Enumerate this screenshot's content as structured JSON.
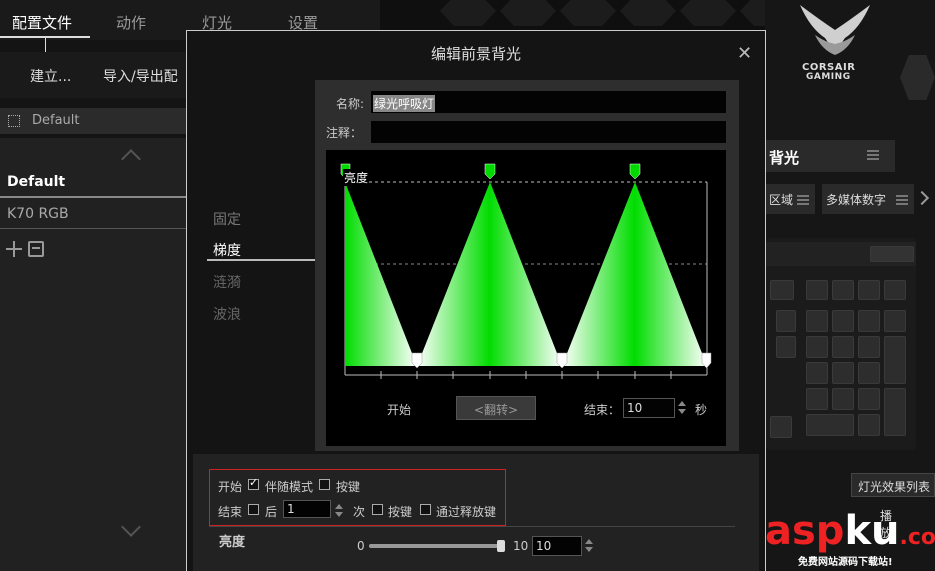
{
  "top_tabs": [
    {
      "label": "配置文件",
      "active": true
    },
    {
      "label": "动作",
      "active": false
    },
    {
      "label": "灯光",
      "active": false
    },
    {
      "label": "设置",
      "active": false
    }
  ],
  "left_actions": {
    "create": "建立...",
    "import_export": "导入/导出配"
  },
  "profile_bar": {
    "label": "Default"
  },
  "profiles": [
    "Default",
    "K70 RGB"
  ],
  "brand": {
    "line1": "CORSAIR",
    "line2": "GAMING"
  },
  "right_panel": {
    "header": "背光",
    "tabs": [
      "区域",
      "多媒体数字"
    ],
    "effect_list_button": "灯光效果列表",
    "play_button": "播放"
  },
  "watermark": {
    "main_a": "asp",
    "main_b": "ku",
    "main_c": ".com",
    "sub": "免费网站源码下载站!"
  },
  "dialog": {
    "title": "编辑前景背光",
    "name_label": "名称:",
    "name_value": "绿光呼吸灯",
    "note_label": "注释：",
    "note_value": "",
    "nav": [
      {
        "label": "固定",
        "active": false
      },
      {
        "label": "梯度",
        "active": true
      },
      {
        "label": "涟漪",
        "active": false
      },
      {
        "label": "波浪",
        "active": false
      }
    ],
    "graph": {
      "brightness_label": "亮度"
    },
    "start_label": "开始",
    "flip_label": "<翻转>",
    "end_label": "结束：",
    "end_value": "10",
    "sec_label": "秒",
    "options": {
      "start_label": "开始",
      "with_mode": "伴随模式",
      "key_1": "按键",
      "end_label": "结束",
      "after": "后",
      "after_value": "1",
      "times": "次",
      "key_2": "按键",
      "release_key": "通过释放键"
    },
    "brightness": {
      "label": "亮度",
      "min": "0",
      "max": "10",
      "value": "10",
      "level_fraction": 1.0
    }
  },
  "colors": {
    "accent_green": "#00e000",
    "red_box": "#cc2222",
    "watermark_red": "#e22222"
  },
  "icons": [
    "close-icon",
    "chip-icon",
    "plus-icon",
    "import-icon",
    "menu-icon",
    "chevron-up-icon",
    "chevron-down-icon",
    "chevron-right-icon",
    "checkbox-icon",
    "corsair-logo"
  ]
}
